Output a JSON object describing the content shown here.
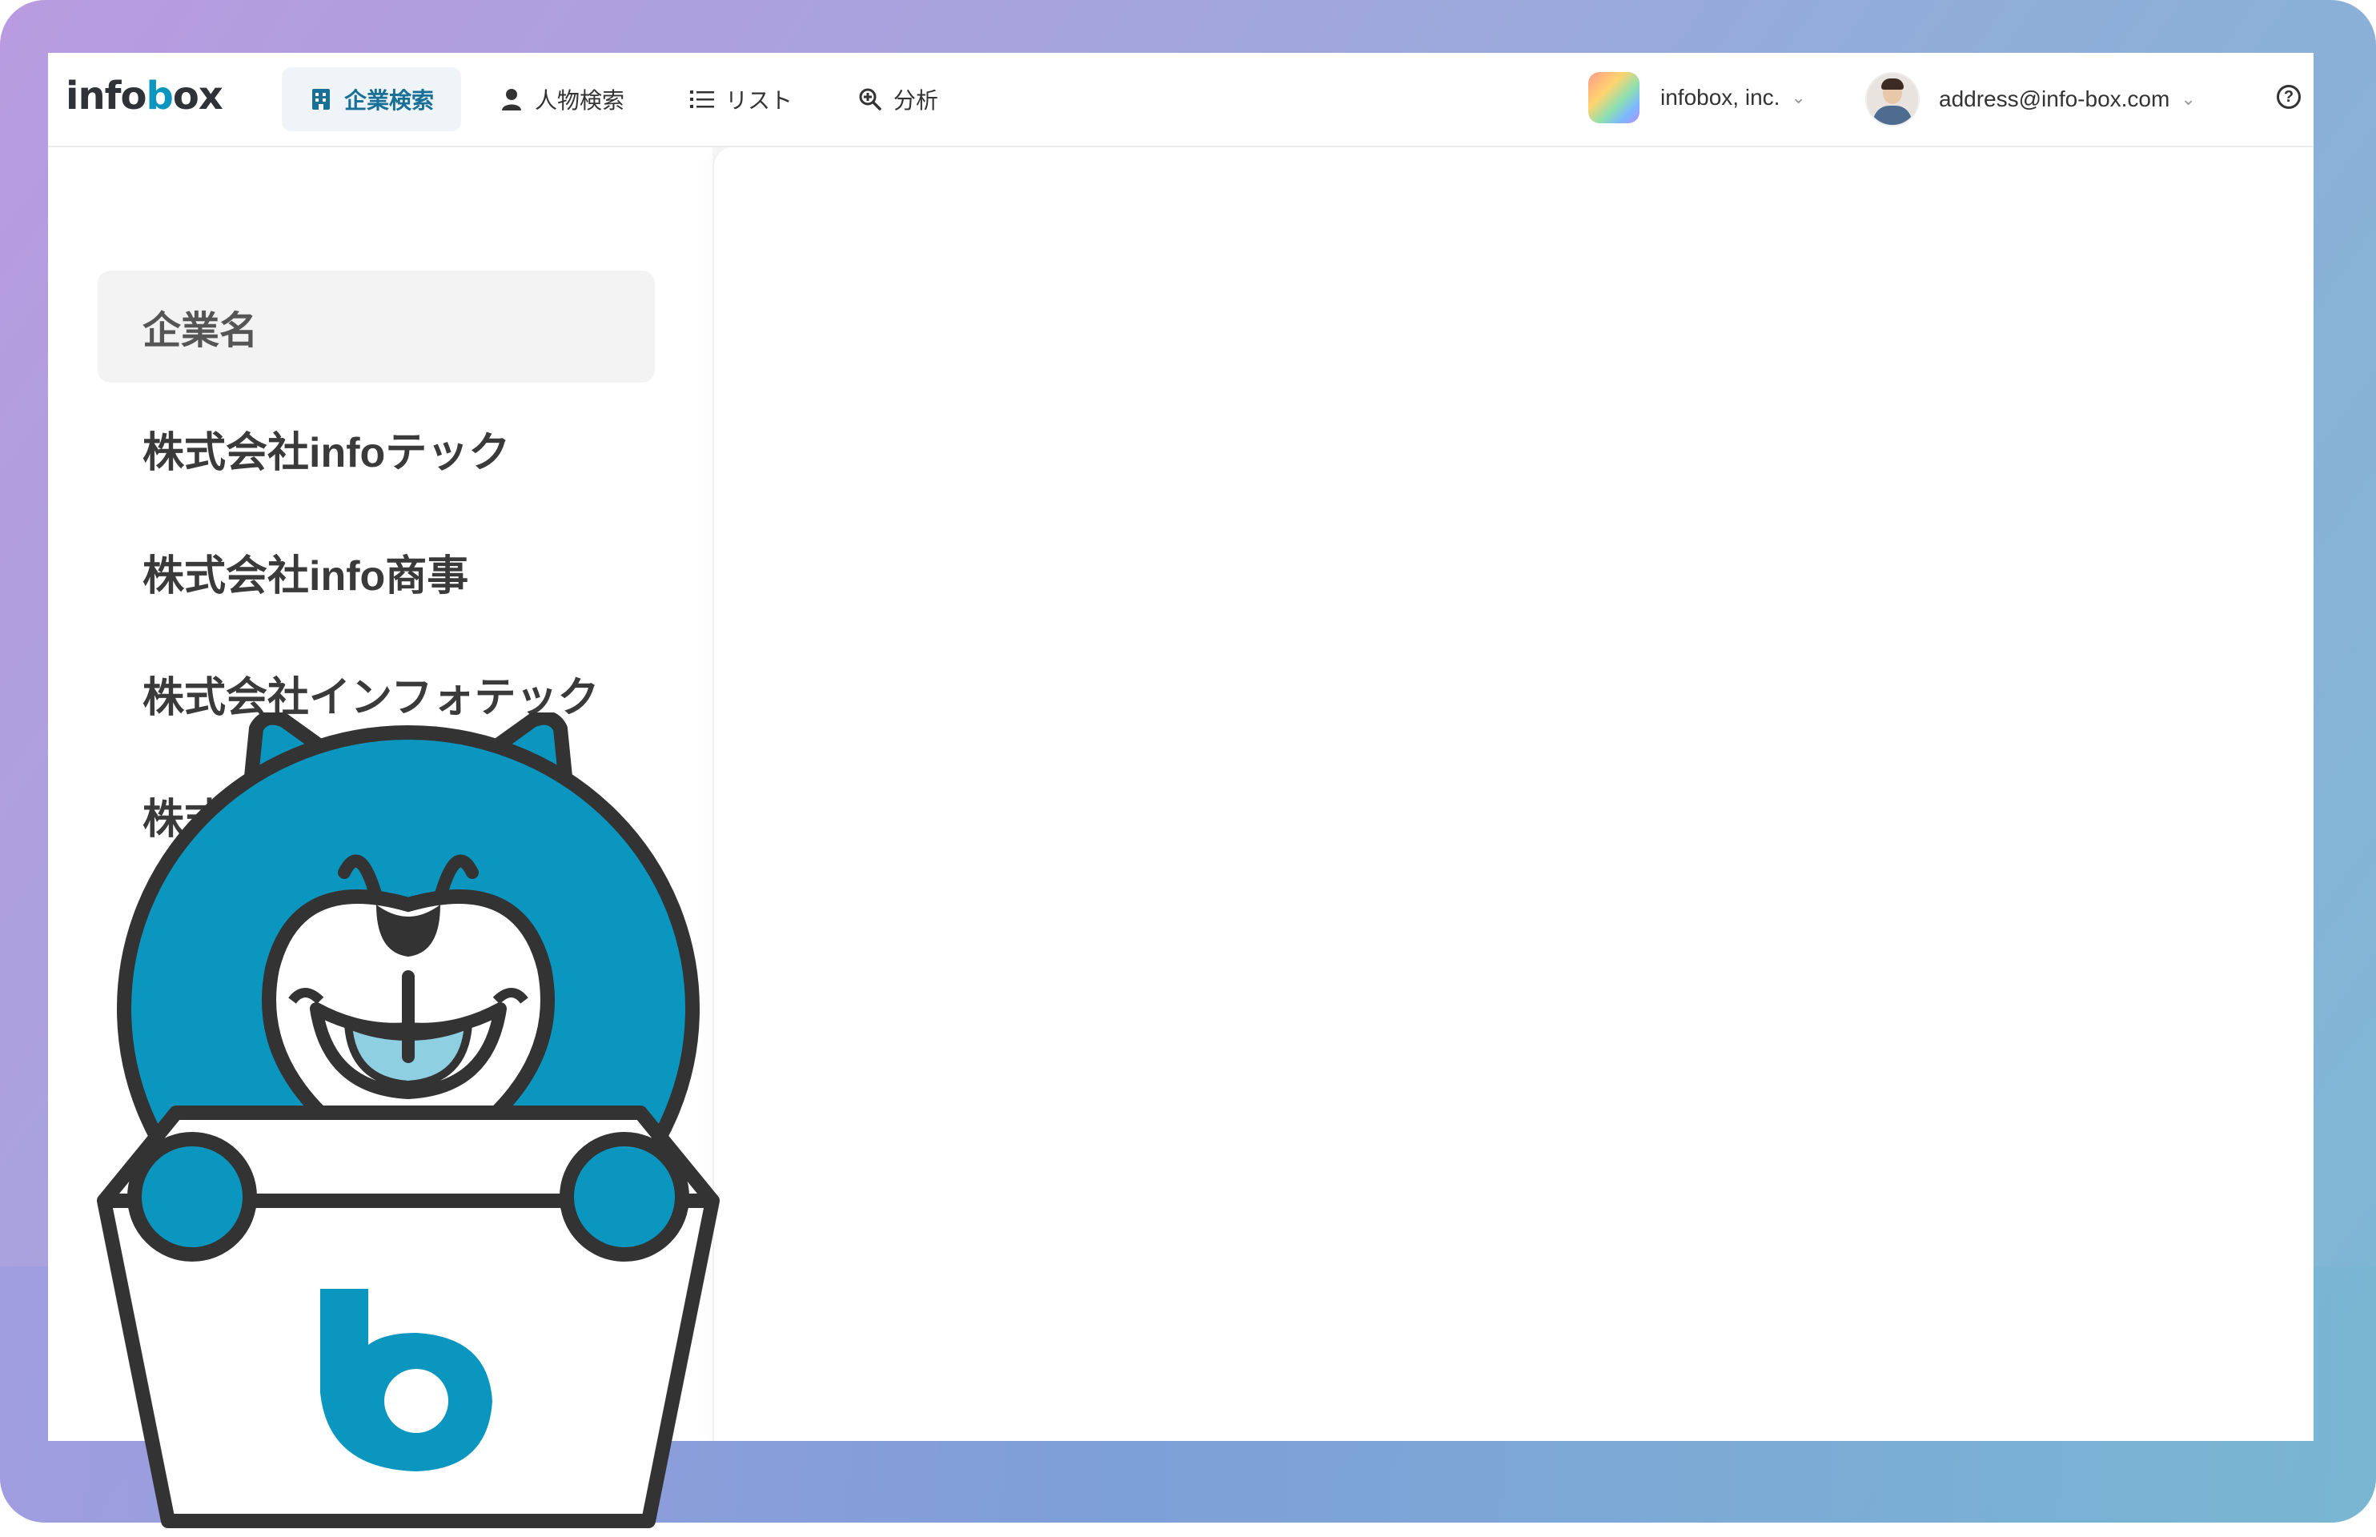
{
  "app": {
    "logo_prefix": "info",
    "logo_accent": "b",
    "logo_suffix": "ox"
  },
  "nav": {
    "items": [
      {
        "label": "企業検索",
        "icon": "building-icon",
        "active": true
      },
      {
        "label": "人物検索",
        "icon": "person-icon",
        "active": false
      },
      {
        "label": "リスト",
        "icon": "list-icon",
        "active": false
      },
      {
        "label": "分析",
        "icon": "analysis-search-icon",
        "active": false
      }
    ]
  },
  "org": {
    "name": "infobox, inc."
  },
  "user": {
    "email": "address@info-box.com"
  },
  "help": {
    "icon": "help-icon",
    "glyph": "?"
  },
  "sidebar": {
    "header": "企業名",
    "items": [
      {
        "label": "株式会社infoテック"
      },
      {
        "label": "株式会社info商事"
      },
      {
        "label": "株式会社インフォテック"
      },
      {
        "label": "株式"
      }
    ]
  },
  "colors": {
    "accent": "#0b96c0",
    "active_nav_text": "#1a6f97",
    "mascot_blue": "#0b96c0"
  }
}
